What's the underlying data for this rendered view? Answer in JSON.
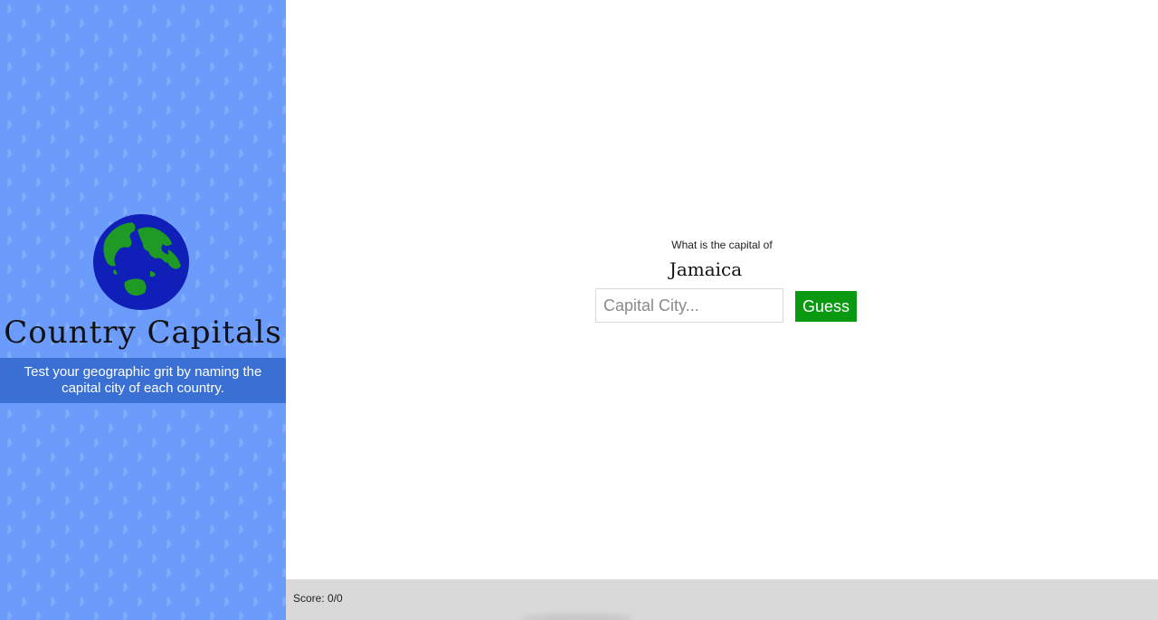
{
  "app": {
    "title": "Country Capitals",
    "tagline": "Test your geographic grit by naming the capital city of each country."
  },
  "quiz": {
    "prompt": "What is the capital of",
    "country": "Jamaica",
    "input_value": "",
    "input_placeholder": "Capital City...",
    "guess_label": "Guess"
  },
  "footer": {
    "score_label": "Score: 0/0"
  },
  "colors": {
    "sidebar_bg": "#6b9cfb",
    "tagline_band": "#3a6fd4",
    "guess_button": "#0a9a12",
    "footer_bg": "#d9d9d9"
  },
  "icons": {
    "logo": "globe-icon",
    "pattern": "leaf-pattern"
  }
}
